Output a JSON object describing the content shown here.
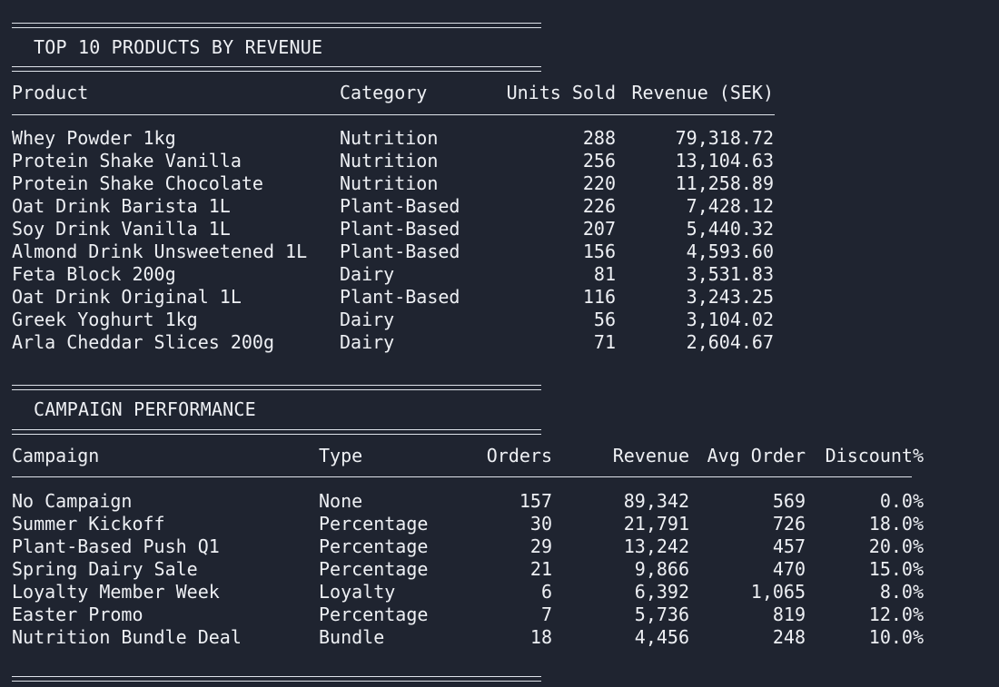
{
  "products": {
    "title": "TOP 10 PRODUCTS BY REVENUE",
    "headers": {
      "product": "Product",
      "category": "Category",
      "units": "Units Sold",
      "revenue": "Revenue (SEK)"
    },
    "rows": [
      {
        "product": "Whey Powder 1kg",
        "category": "Nutrition",
        "units": "288",
        "revenue": "79,318.72"
      },
      {
        "product": "Protein Shake Vanilla",
        "category": "Nutrition",
        "units": "256",
        "revenue": "13,104.63"
      },
      {
        "product": "Protein Shake Chocolate",
        "category": "Nutrition",
        "units": "220",
        "revenue": "11,258.89"
      },
      {
        "product": "Oat Drink Barista 1L",
        "category": "Plant-Based",
        "units": "226",
        "revenue": "7,428.12"
      },
      {
        "product": "Soy Drink Vanilla 1L",
        "category": "Plant-Based",
        "units": "207",
        "revenue": "5,440.32"
      },
      {
        "product": "Almond Drink Unsweetened 1L",
        "category": "Plant-Based",
        "units": "156",
        "revenue": "4,593.60"
      },
      {
        "product": "Feta Block 200g",
        "category": "Dairy",
        "units": "81",
        "revenue": "3,531.83"
      },
      {
        "product": "Oat Drink Original 1L",
        "category": "Plant-Based",
        "units": "116",
        "revenue": "3,243.25"
      },
      {
        "product": "Greek Yoghurt 1kg",
        "category": "Dairy",
        "units": "56",
        "revenue": "3,104.02"
      },
      {
        "product": "Arla Cheddar Slices 200g",
        "category": "Dairy",
        "units": "71",
        "revenue": "2,604.67"
      }
    ]
  },
  "campaigns": {
    "title": "CAMPAIGN PERFORMANCE",
    "headers": {
      "campaign": "Campaign",
      "type": "Type",
      "orders": "Orders",
      "revenue": "Revenue",
      "avg_order": "Avg Order",
      "discount": "Discount%"
    },
    "rows": [
      {
        "campaign": "No Campaign",
        "type": "None",
        "orders": "157",
        "revenue": "89,342",
        "avg_order": "569",
        "discount": "0.0%"
      },
      {
        "campaign": "Summer Kickoff",
        "type": "Percentage",
        "orders": "30",
        "revenue": "21,791",
        "avg_order": "726",
        "discount": "18.0%"
      },
      {
        "campaign": "Plant-Based Push Q1",
        "type": "Percentage",
        "orders": "29",
        "revenue": "13,242",
        "avg_order": "457",
        "discount": "20.0%"
      },
      {
        "campaign": "Spring Dairy Sale",
        "type": "Percentage",
        "orders": "21",
        "revenue": "9,866",
        "avg_order": "470",
        "discount": "15.0%"
      },
      {
        "campaign": "Loyalty Member Week",
        "type": "Loyalty",
        "orders": "6",
        "revenue": "6,392",
        "avg_order": "1,065",
        "discount": "8.0%"
      },
      {
        "campaign": "Easter Promo",
        "type": "Percentage",
        "orders": "7",
        "revenue": "5,736",
        "avg_order": "819",
        "discount": "12.0%"
      },
      {
        "campaign": "Nutrition Bundle Deal",
        "type": "Bundle",
        "orders": "18",
        "revenue": "4,456",
        "avg_order": "248",
        "discount": "10.0%"
      }
    ]
  },
  "colors": {
    "background": "#1f2430",
    "text": "#eef0f4"
  }
}
